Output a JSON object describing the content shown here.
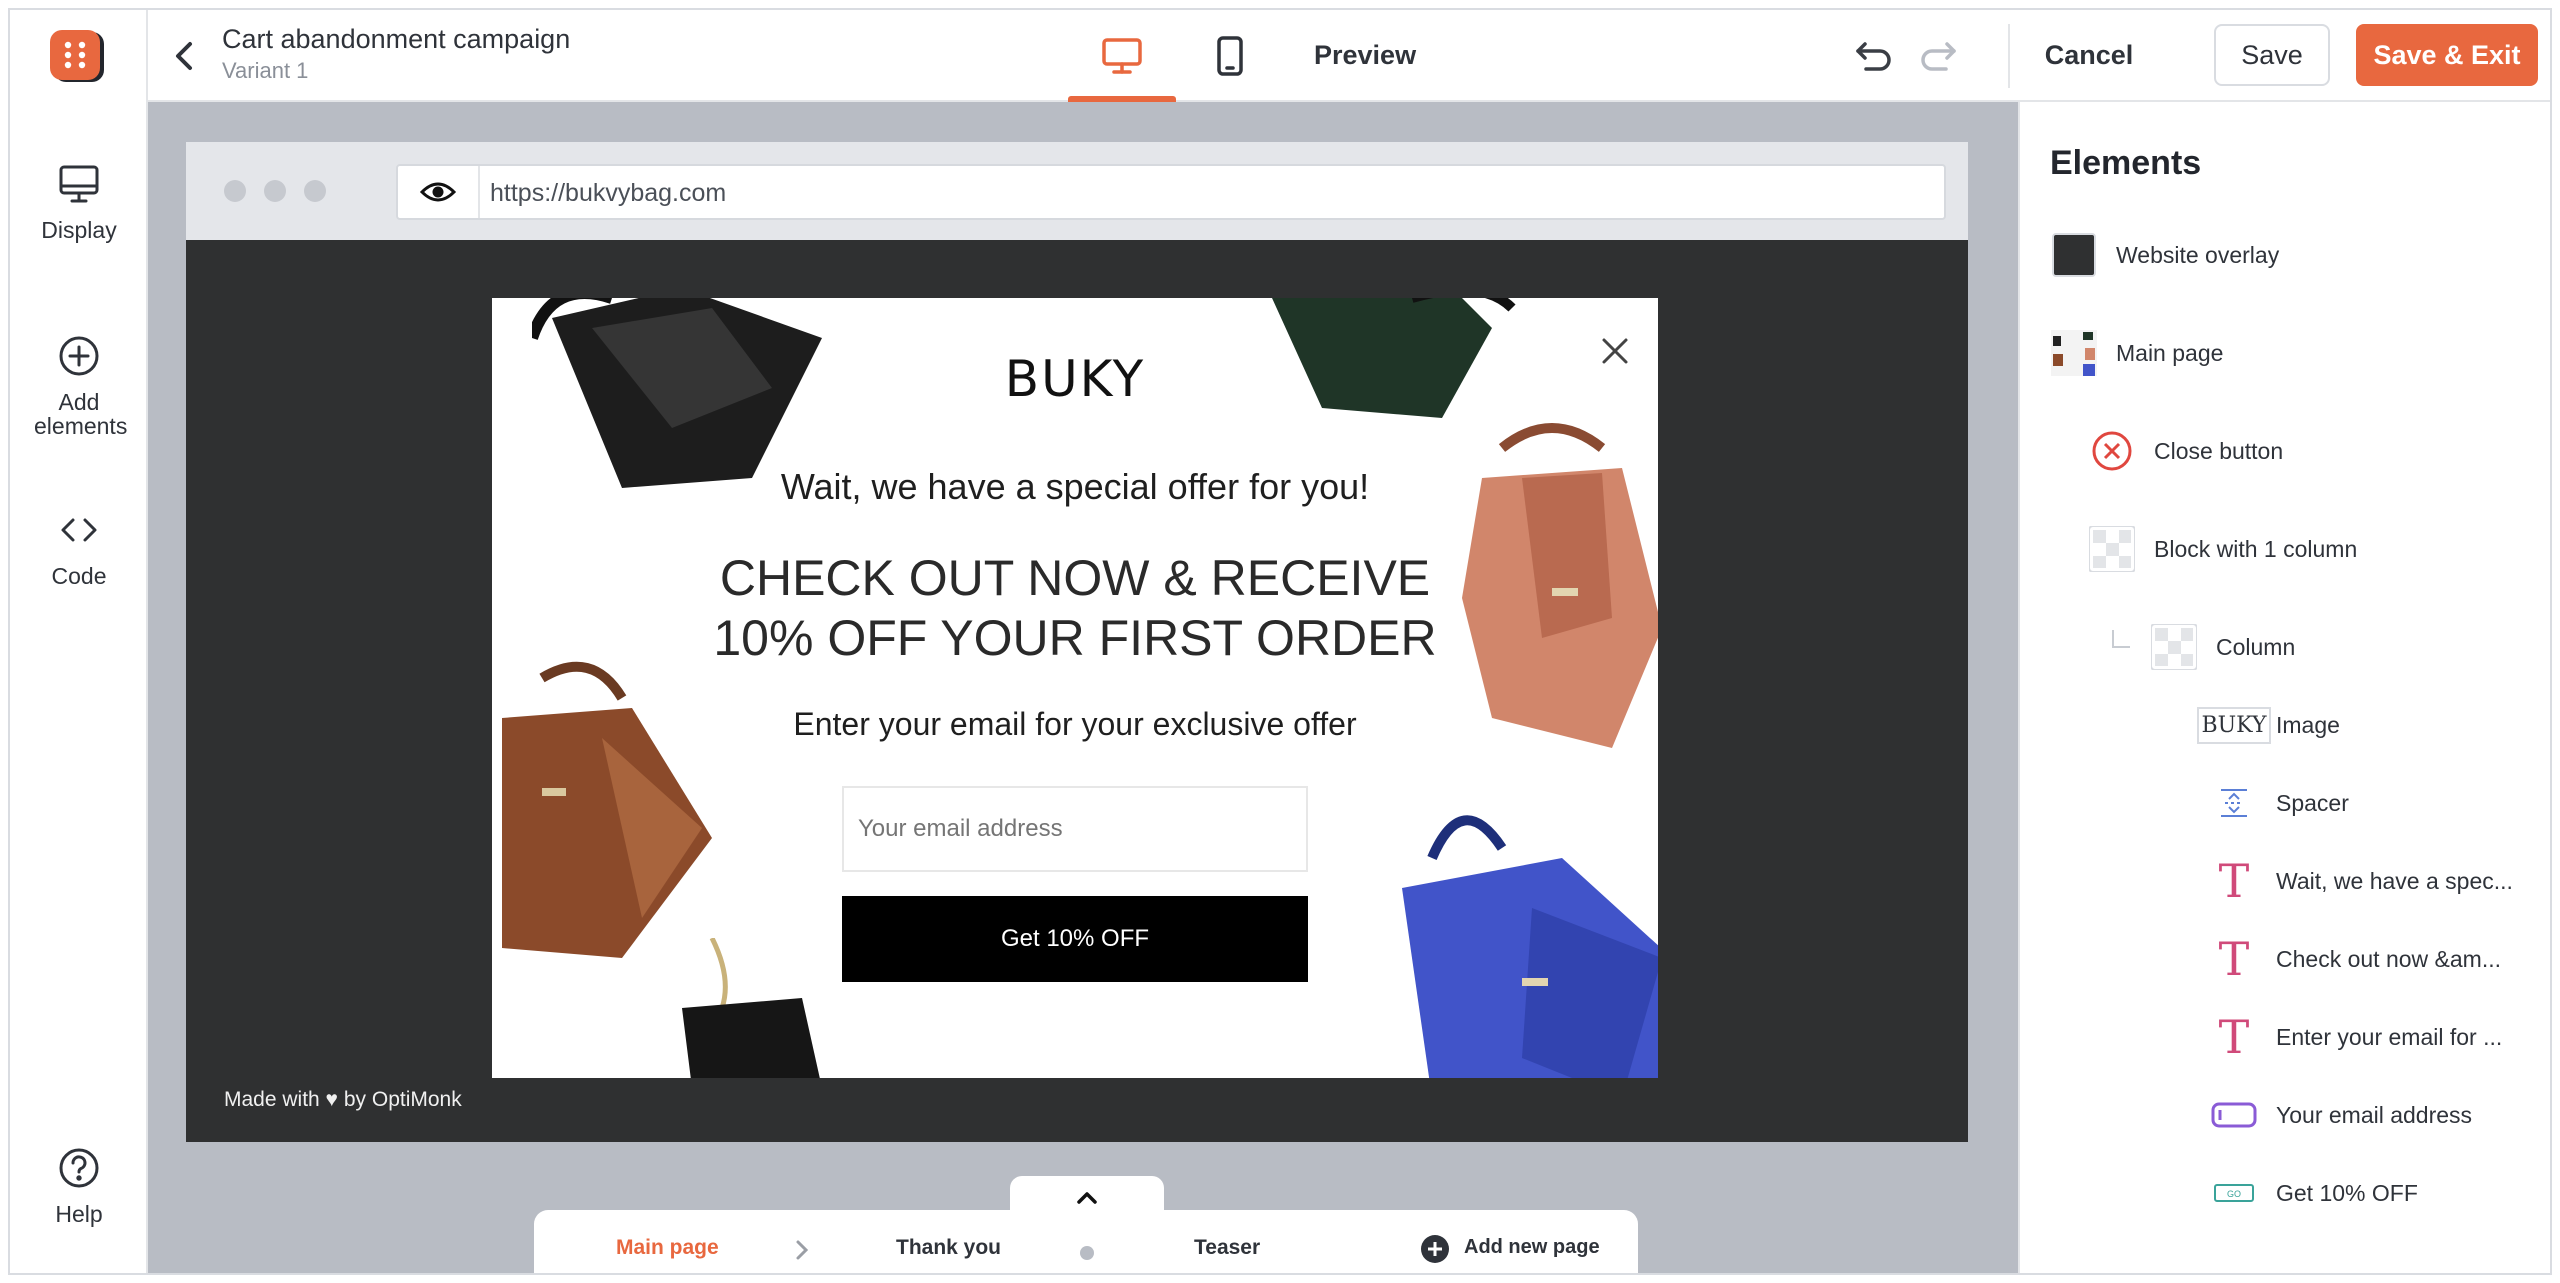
{
  "header": {
    "title": "Cart abandonment campaign",
    "subtitle": "Variant 1",
    "preview_label": "Preview",
    "cancel_label": "Cancel",
    "save_label": "Save",
    "save_exit_label": "Save & Exit"
  },
  "rail": {
    "items": [
      {
        "label": "Display",
        "icon": "monitor-icon"
      },
      {
        "label": "Add elements",
        "icon": "add-circle-icon"
      },
      {
        "label": "Code",
        "icon": "code-icon"
      },
      {
        "label": "Help",
        "icon": "help-icon"
      }
    ]
  },
  "browser": {
    "url": "https://bukvybag.com",
    "made_with": "Made with ♥ by OptiMonk"
  },
  "popup": {
    "brand": "BUKY",
    "line1": "Wait, we have a special offer for you!",
    "headline_1": "CHECK OUT NOW & RECEIVE",
    "headline_2": "10% OFF YOUR FIRST ORDER",
    "line3": "Enter your email for your exclusive offer",
    "email_placeholder": "Your email address",
    "button_label": "Get 10% OFF"
  },
  "pages": {
    "main": "Main page",
    "thanks": "Thank you",
    "teaser": "Teaser",
    "add": "Add new page"
  },
  "panel": {
    "title": "Elements",
    "items": [
      {
        "label": "Website overlay"
      },
      {
        "label": "Main page"
      },
      {
        "label": "Close button"
      },
      {
        "label": "Block with 1 column"
      },
      {
        "label": "Column"
      },
      {
        "label": "Image"
      },
      {
        "label": "Spacer"
      },
      {
        "label": "Wait, we have a spec..."
      },
      {
        "label": "Check out now &am..."
      },
      {
        "label": "Enter your email for ..."
      },
      {
        "label": "Your email address"
      },
      {
        "label": "Get 10% OFF"
      }
    ]
  },
  "colors": {
    "accent": "#e8683f",
    "overlay": "#2f3031",
    "canvas_bg": "#b8bcc4"
  }
}
